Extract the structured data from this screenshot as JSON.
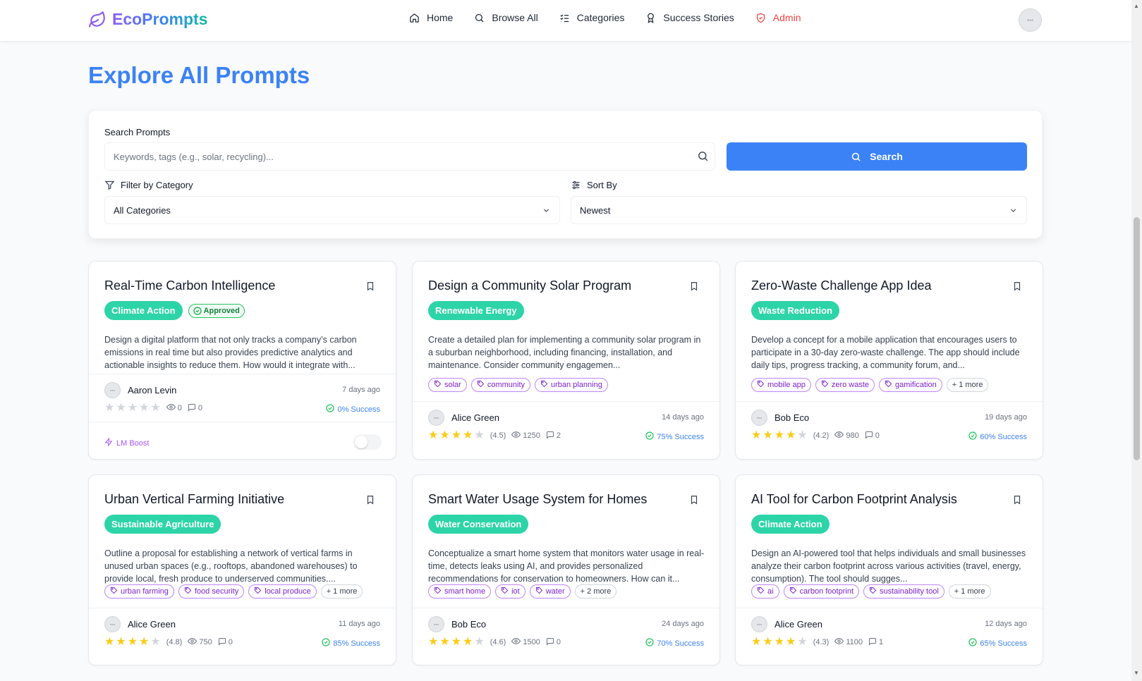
{
  "header": {
    "logo": "EcoPrompts",
    "nav": [
      {
        "label": "Home"
      },
      {
        "label": "Browse All"
      },
      {
        "label": "Categories"
      },
      {
        "label": "Success Stories"
      },
      {
        "label": "Admin"
      }
    ]
  },
  "page_title": "Explore All Prompts",
  "search": {
    "label": "Search Prompts",
    "placeholder": "Keywords, tags (e.g., solar, recycling)...",
    "button": "Search",
    "filter_label": "Filter by Category",
    "filter_value": "All Categories",
    "sort_label": "Sort By",
    "sort_value": "Newest"
  },
  "cards": [
    {
      "title": "Real-Time Carbon Intelligence",
      "category": "Climate Action",
      "approved": "Approved",
      "description": "Design a digital platform that not only tracks a company’s carbon emissions in real time but also provides predictive analytics and actionable insights to reduce them. How would it integrate with...",
      "author": "Aaron Levin",
      "date": "7 days ago",
      "rating": 0,
      "views": "0",
      "comments": "0",
      "success": "0% Success",
      "boost": "LM Boost"
    },
    {
      "title": "Design a Community Solar Program",
      "category": "Renewable Energy",
      "description": "Create a detailed plan for implementing a community solar program in a suburban neighborhood, including financing, installation, and maintenance. Consider community engagemen...",
      "tags": [
        "solar",
        "community",
        "urban planning"
      ],
      "author": "Alice Green",
      "date": "14 days ago",
      "rating": 4,
      "rating_text": "(4.5)",
      "views": "1250",
      "comments": "2",
      "success": "75% Success"
    },
    {
      "title": "Zero-Waste Challenge App Idea",
      "category": "Waste Reduction",
      "description": "Develop a concept for a mobile application that encourages users to participate in a 30-day zero-waste challenge. The app should include daily tips, progress tracking, a community forum, and...",
      "tags": [
        "mobile app",
        "zero waste",
        "gamification"
      ],
      "more": "+ 1 more",
      "author": "Bob Eco",
      "date": "19 days ago",
      "rating": 4,
      "rating_text": "(4.2)",
      "views": "980",
      "comments": "0",
      "success": "60% Success"
    },
    {
      "title": "Urban Vertical Farming Initiative",
      "category": "Sustainable Agriculture",
      "description": "Outline a proposal for establishing a network of vertical farms in unused urban spaces (e.g., rooftops, abandoned warehouses) to provide local, fresh produce to underserved communities....",
      "tags": [
        "urban farming",
        "food security",
        "local produce"
      ],
      "more": "+ 1 more",
      "author": "Alice Green",
      "date": "11 days ago",
      "rating": 4,
      "rating_text": "(4.8)",
      "views": "750",
      "comments": "0",
      "success": "85% Success"
    },
    {
      "title": "Smart Water Usage System for Homes",
      "category": "Water Conservation",
      "description": "Conceptualize a smart home system that monitors water usage in real-time, detects leaks using AI, and provides personalized recommendations for conservation to homeowners. How can it...",
      "tags": [
        "smart home",
        "iot",
        "water"
      ],
      "more": "+ 2 more",
      "author": "Bob Eco",
      "date": "24 days ago",
      "rating": 4,
      "rating_text": "(4.6)",
      "views": "1500",
      "comments": "0",
      "success": "70% Success"
    },
    {
      "title": "AI Tool for Carbon Footprint Analysis",
      "category": "Climate Action",
      "description": "Design an AI-powered tool that helps individuals and small businesses analyze their carbon footprint across various activities (travel, energy, consumption). The tool should sugges...",
      "tags": [
        "ai",
        "carbon footprint",
        "sustainability tool"
      ],
      "more": "+ 1 more",
      "author": "Alice Green",
      "date": "12 days ago",
      "rating": 4,
      "rating_text": "(4.3)",
      "views": "1100",
      "comments": "1",
      "success": "65% Success"
    }
  ]
}
